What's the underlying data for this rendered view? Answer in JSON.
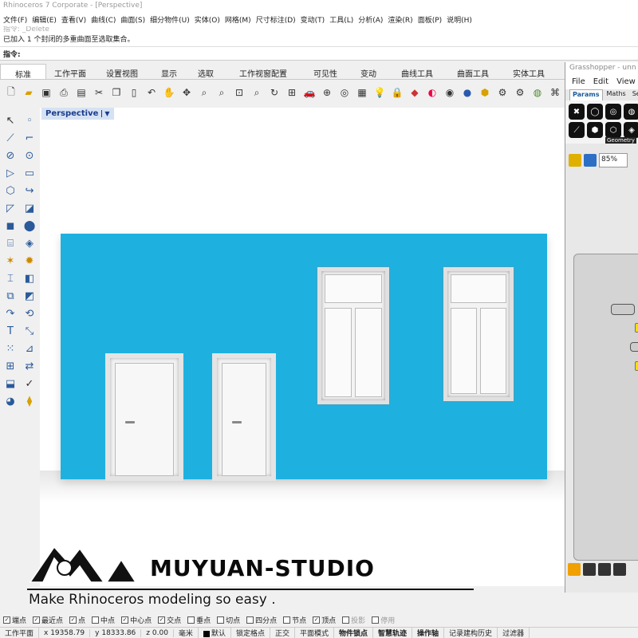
{
  "app": {
    "title": "Rhinoceros 7 Corporate - [Perspective]"
  },
  "menu": [
    "文件(F)",
    "编辑(E)",
    "查看(V)",
    "曲线(C)",
    "曲面(S)",
    "细分物件(U)",
    "实体(O)",
    "网格(M)",
    "尺寸标注(D)",
    "变动(T)",
    "工具(L)",
    "分析(A)",
    "渲染(R)",
    "面板(P)",
    "说明(H)"
  ],
  "command": {
    "history_faded": "指令: _Delete",
    "message": "已加入 1 个封闭的多重曲面至选取集合。",
    "prompt": "指令:"
  },
  "tabs": [
    "标准",
    "工作平面",
    "设置视图",
    "显示",
    "选取",
    "工作视窗配置",
    "可见性",
    "变动",
    "曲线工具",
    "曲面工具",
    "实体工具"
  ],
  "active_tab": "标准",
  "viewport": {
    "name": "Perspective",
    "wall_color": "#1eb1e0"
  },
  "grasshopper": {
    "title": "Grasshopper - unn",
    "menu": [
      "File",
      "Edit",
      "View"
    ],
    "tabs": [
      "Params",
      "Maths",
      "Se"
    ],
    "group_label": "Geometry",
    "zoom": "85%"
  },
  "watermark": {
    "brand": "MUYUAN-STUDIO",
    "tagline": "Make Rhinoceros modeling so easy ."
  },
  "osnaps": [
    {
      "label": "端点",
      "checked": true
    },
    {
      "label": "最近点",
      "checked": true
    },
    {
      "label": "点",
      "checked": true
    },
    {
      "label": "中点",
      "checked": false
    },
    {
      "label": "中心点",
      "checked": true
    },
    {
      "label": "交点",
      "checked": true
    },
    {
      "label": "垂点",
      "checked": false
    },
    {
      "label": "切点",
      "checked": false
    },
    {
      "label": "四分点",
      "checked": false
    },
    {
      "label": "节点",
      "checked": false
    },
    {
      "label": "顶点",
      "checked": true
    },
    {
      "label": "投影",
      "checked": false,
      "dim": true
    },
    {
      "label": "停用",
      "checked": false,
      "dim": true
    }
  ],
  "status": {
    "cplane": "工作平面",
    "x": "x 19358.79",
    "y": "y 18333.86",
    "z": "z 0.00",
    "unit": "毫米",
    "layer": "默认",
    "items": [
      "锁定格点",
      "正交",
      "平面模式",
      "物件锁点",
      "智慧轨迹",
      "操作轴",
      "记录建构历史",
      "过滤器"
    ]
  }
}
